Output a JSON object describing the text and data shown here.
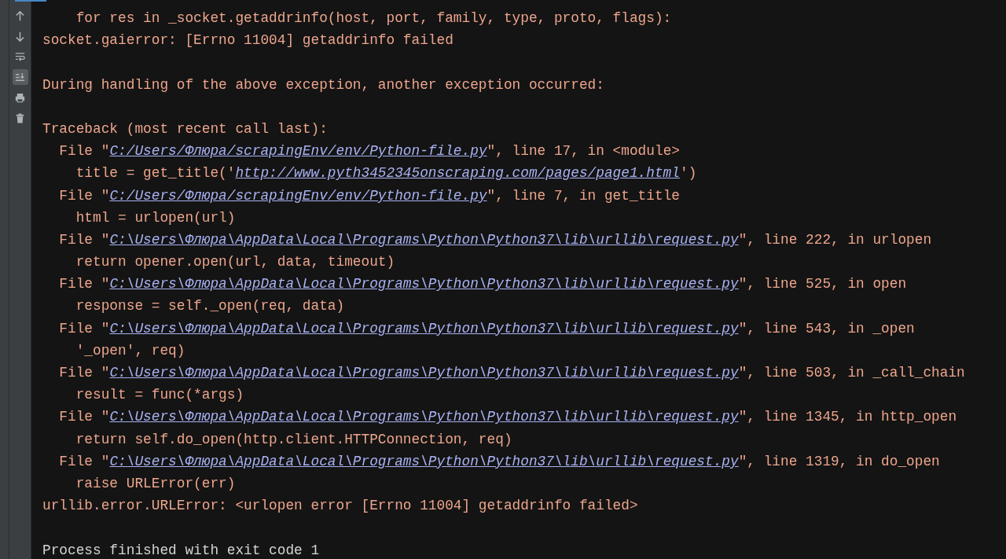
{
  "toolbar": {
    "items": [
      {
        "kind": "up",
        "selected": false
      },
      {
        "kind": "down",
        "selected": false
      },
      {
        "kind": "wrap",
        "selected": false
      },
      {
        "kind": "scroll-end",
        "selected": true
      },
      {
        "kind": "print",
        "selected": false
      },
      {
        "kind": "trash",
        "selected": false
      }
    ]
  },
  "console": {
    "lines": [
      {
        "kind": "error",
        "segments": [
          {
            "kind": "text",
            "text": "    for res in _socket.getaddrinfo(host, port, family, type, proto, flags):"
          }
        ]
      },
      {
        "kind": "error",
        "segments": [
          {
            "kind": "text",
            "text": "socket.gaierror: [Errno 11004] getaddrinfo failed"
          }
        ]
      },
      {
        "kind": "blank"
      },
      {
        "kind": "error",
        "segments": [
          {
            "kind": "text",
            "text": "During handling of the above exception, another exception occurred:"
          }
        ]
      },
      {
        "kind": "blank"
      },
      {
        "kind": "error",
        "segments": [
          {
            "kind": "text",
            "text": "Traceback (most recent call last):"
          }
        ]
      },
      {
        "kind": "error",
        "segments": [
          {
            "kind": "text",
            "text": "  File \""
          },
          {
            "kind": "link",
            "text": "C:/Users/Флюра/scrapingEnv/env/Python-file.py"
          },
          {
            "kind": "text",
            "text": "\", line 17, in <module>"
          }
        ]
      },
      {
        "kind": "error",
        "segments": [
          {
            "kind": "text",
            "text": "    title = get_title('"
          },
          {
            "kind": "link",
            "text": "http://www.pyth3452345onscraping.com/pages/page1.html"
          },
          {
            "kind": "text",
            "text": "')"
          }
        ]
      },
      {
        "kind": "error",
        "segments": [
          {
            "kind": "text",
            "text": "  File \""
          },
          {
            "kind": "link",
            "text": "C:/Users/Флюра/scrapingEnv/env/Python-file.py"
          },
          {
            "kind": "text",
            "text": "\", line 7, in get_title"
          }
        ]
      },
      {
        "kind": "error",
        "segments": [
          {
            "kind": "text",
            "text": "    html = urlopen(url)"
          }
        ]
      },
      {
        "kind": "error",
        "segments": [
          {
            "kind": "text",
            "text": "  File \""
          },
          {
            "kind": "link",
            "text": "C:\\Users\\Флюра\\AppData\\Local\\Programs\\Python\\Python37\\lib\\urllib\\request.py"
          },
          {
            "kind": "text",
            "text": "\", line 222, in urlopen"
          }
        ]
      },
      {
        "kind": "error",
        "segments": [
          {
            "kind": "text",
            "text": "    return opener.open(url, data, timeout)"
          }
        ]
      },
      {
        "kind": "error",
        "segments": [
          {
            "kind": "text",
            "text": "  File \""
          },
          {
            "kind": "link",
            "text": "C:\\Users\\Флюра\\AppData\\Local\\Programs\\Python\\Python37\\lib\\urllib\\request.py"
          },
          {
            "kind": "text",
            "text": "\", line 525, in open"
          }
        ]
      },
      {
        "kind": "error",
        "segments": [
          {
            "kind": "text",
            "text": "    response = self._open(req, data)"
          }
        ]
      },
      {
        "kind": "error",
        "segments": [
          {
            "kind": "text",
            "text": "  File \""
          },
          {
            "kind": "link",
            "text": "C:\\Users\\Флюра\\AppData\\Local\\Programs\\Python\\Python37\\lib\\urllib\\request.py"
          },
          {
            "kind": "text",
            "text": "\", line 543, in _open"
          }
        ]
      },
      {
        "kind": "error",
        "segments": [
          {
            "kind": "text",
            "text": "    '_open', req)"
          }
        ]
      },
      {
        "kind": "error",
        "segments": [
          {
            "kind": "text",
            "text": "  File \""
          },
          {
            "kind": "link",
            "text": "C:\\Users\\Флюра\\AppData\\Local\\Programs\\Python\\Python37\\lib\\urllib\\request.py"
          },
          {
            "kind": "text",
            "text": "\", line 503, in _call_chain"
          }
        ]
      },
      {
        "kind": "error",
        "segments": [
          {
            "kind": "text",
            "text": "    result = func(*args)"
          }
        ]
      },
      {
        "kind": "error",
        "segments": [
          {
            "kind": "text",
            "text": "  File \""
          },
          {
            "kind": "link",
            "text": "C:\\Users\\Флюра\\AppData\\Local\\Programs\\Python\\Python37\\lib\\urllib\\request.py"
          },
          {
            "kind": "text",
            "text": "\", line 1345, in http_open"
          }
        ]
      },
      {
        "kind": "error",
        "segments": [
          {
            "kind": "text",
            "text": "    return self.do_open(http.client.HTTPConnection, req)"
          }
        ]
      },
      {
        "kind": "error",
        "segments": [
          {
            "kind": "text",
            "text": "  File \""
          },
          {
            "kind": "link",
            "text": "C:\\Users\\Флюра\\AppData\\Local\\Programs\\Python\\Python37\\lib\\urllib\\request.py"
          },
          {
            "kind": "text",
            "text": "\", line 1319, in do_open"
          }
        ]
      },
      {
        "kind": "error",
        "segments": [
          {
            "kind": "text",
            "text": "    raise URLError(err)"
          }
        ]
      },
      {
        "kind": "error",
        "segments": [
          {
            "kind": "text",
            "text": "urllib.error.URLError: <urlopen error [Errno 11004] getaddrinfo failed>"
          }
        ]
      },
      {
        "kind": "blank"
      },
      {
        "kind": "info",
        "segments": [
          {
            "kind": "text",
            "text": "Process finished with exit code 1"
          }
        ]
      }
    ]
  }
}
